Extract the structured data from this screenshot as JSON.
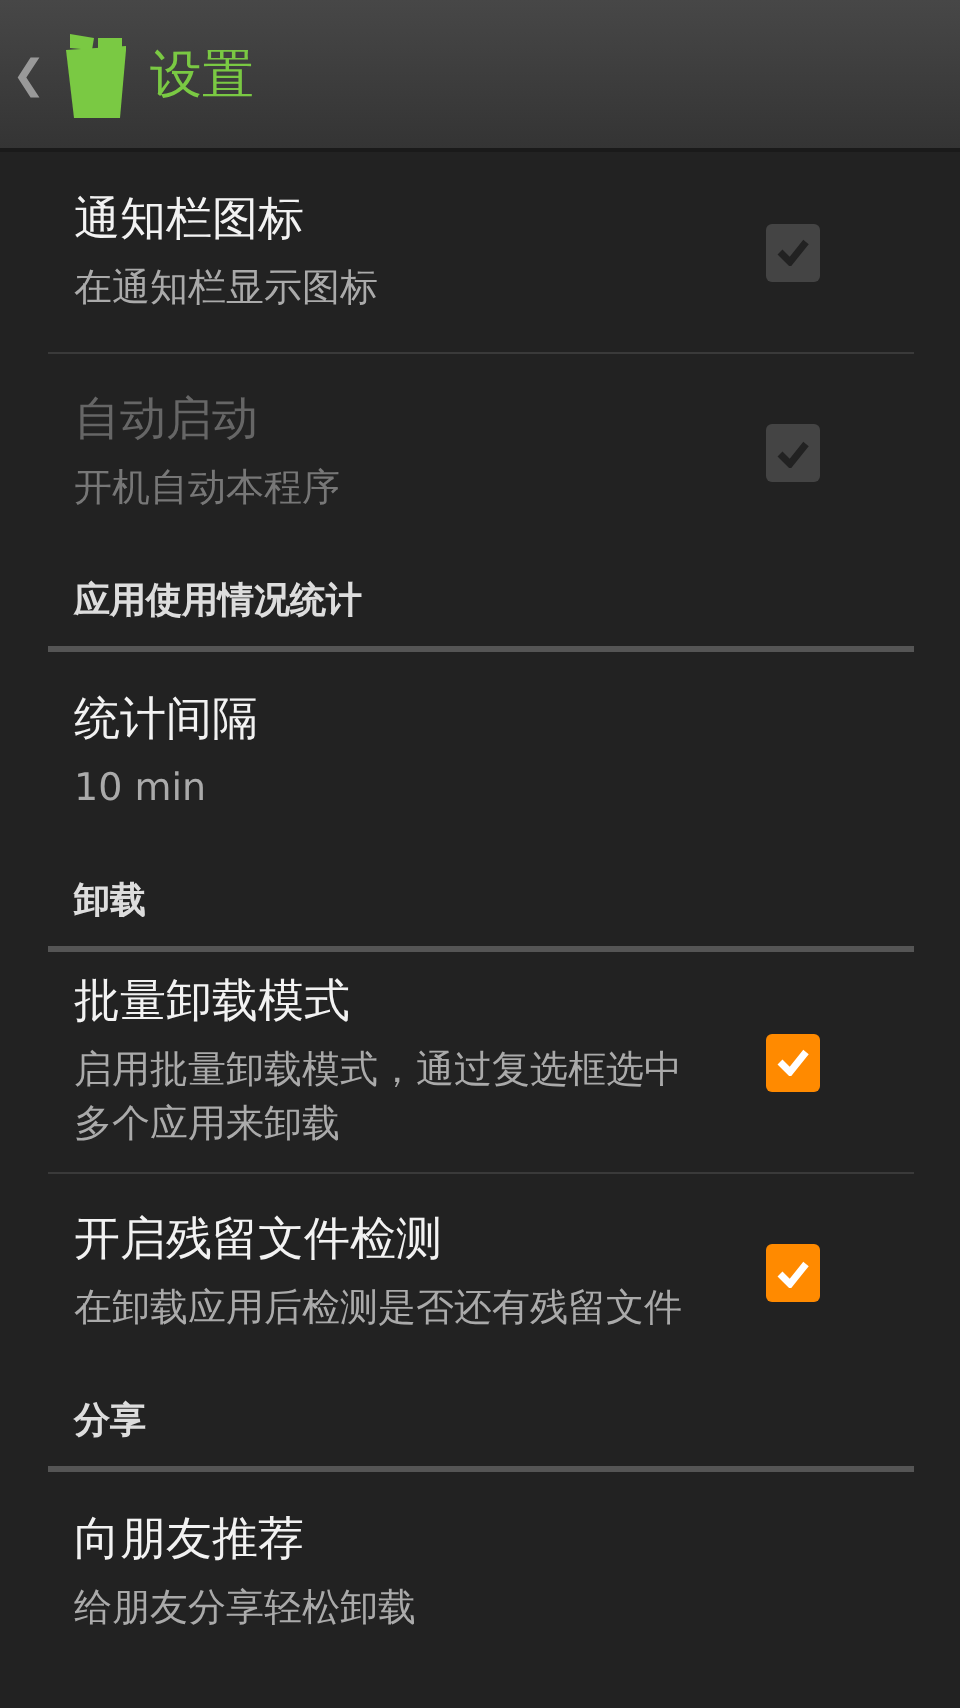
{
  "action_bar": {
    "back": "❮",
    "title": "设置"
  },
  "items": [
    {
      "kind": "setting",
      "title": "通知栏图标",
      "summary": "在通知栏显示图标",
      "disabled": false,
      "checkbox": {
        "checked": true,
        "enabled": false
      }
    },
    {
      "kind": "setting",
      "title": "自动启动",
      "summary": "开机自动本程序",
      "disabled": true,
      "checkbox": {
        "checked": true,
        "enabled": false
      }
    },
    {
      "kind": "category",
      "title": "应用使用情况统计"
    },
    {
      "kind": "setting",
      "title": "统计间隔",
      "summary": "10 min",
      "disabled": false
    },
    {
      "kind": "category",
      "title": "卸载"
    },
    {
      "kind": "setting",
      "title": "批量卸载模式",
      "summary": "启用批量卸载模式，通过复选框选中多个应用来卸载",
      "disabled": false,
      "checkbox": {
        "checked": true,
        "enabled": true
      }
    },
    {
      "kind": "setting",
      "title": "开启残留文件检测",
      "summary": "在卸载应用后检测是否还有残留文件",
      "disabled": false,
      "checkbox": {
        "checked": true,
        "enabled": true
      }
    },
    {
      "kind": "category",
      "title": "分享"
    },
    {
      "kind": "setting",
      "title": "向朋友推荐",
      "summary": "给朋友分享轻松卸载",
      "disabled": false
    }
  ]
}
